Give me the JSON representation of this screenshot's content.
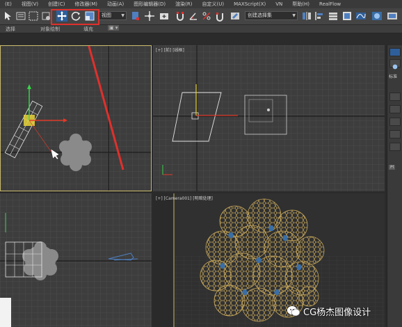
{
  "menubar": {
    "items": [
      "(E)",
      "视图(V)",
      "创建(C)",
      "修改器(M)",
      "动画(A)",
      "图形编辑器(D)",
      "渲染(R)",
      "自定义(U)",
      "MAXScript(X)",
      "VN",
      "帮助(H)",
      "RealFlow"
    ]
  },
  "toolbar": {
    "view_dropdown": "视图",
    "selection_set_dropdown": "创建选择集"
  },
  "ribbon": {
    "tabs": [
      "选择",
      "对象绘制",
      "填充"
    ]
  },
  "viewports": {
    "top_left": {
      "label": ""
    },
    "top_right": {
      "label": "[+] [前] [线框]"
    },
    "bottom_left": {
      "label": ""
    },
    "bottom_right": {
      "label": "[+] [Camera001] [明暗处理]"
    }
  },
  "command_panel": {
    "label_1": "标准",
    "label_2": "Pl"
  },
  "watermark": {
    "text": "CG杨杰图像设计"
  },
  "colors": {
    "highlight": "#e0302c",
    "grid": "#555555",
    "viewport_bg": "#3d3d3d",
    "sphere_wire": "#c8a85a",
    "hex_fill": "#3a6ea5"
  }
}
